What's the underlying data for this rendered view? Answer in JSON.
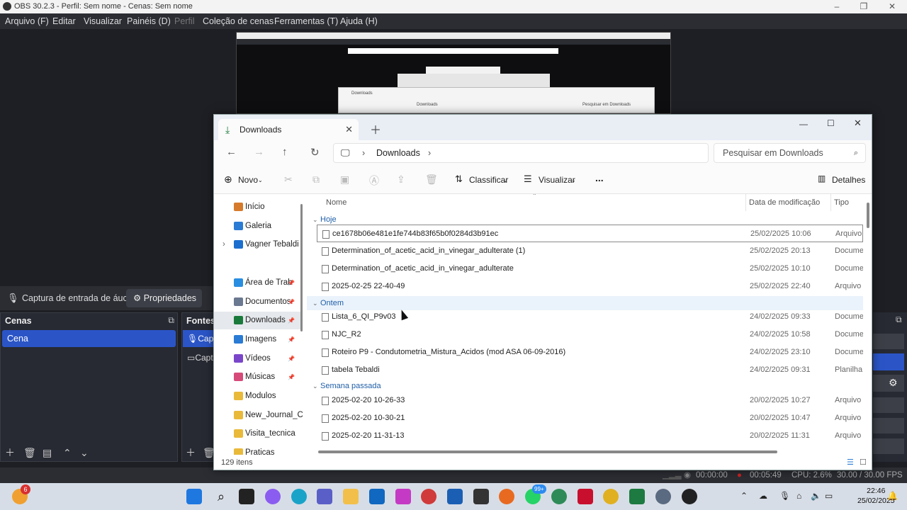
{
  "obs": {
    "title": "OBS 30.2.3 - Perfil: Sem nome - Cenas: Sem nome",
    "menu": [
      "Arquivo (F)",
      "Editar",
      "Visualizar",
      "Painéis (D)",
      "Perfil",
      "Coleção de cenas",
      "Ferramentas (T)",
      "Ajuda (H)"
    ],
    "source_label": "Captura de entrada de áuc",
    "properties_button": "Propriedades",
    "scenes_title": "Cenas",
    "scene_item": "Cena",
    "sources_title": "Fontes",
    "sources": [
      "Capt",
      "Capt"
    ],
    "status": {
      "rec_time": "00:00:00",
      "stream_time": "00:05:49",
      "cpu": "CPU: 2.6%",
      "fps": "30.00 / 30.00 FPS"
    },
    "mini_downloads": "Downloads",
    "mini_search": "Pesquisar em Downloads"
  },
  "explorer": {
    "tab_title": "Downloads",
    "breadcrumb": "Downloads",
    "search_placeholder": "Pesquisar em Downloads",
    "toolbar": {
      "new": "Novo",
      "sort": "Classificar",
      "view": "Visualizar",
      "more": "...",
      "details": "Detalhes"
    },
    "nav": [
      {
        "label": "Início",
        "color": "#d67a2b",
        "pin": false
      },
      {
        "label": "Galeria",
        "color": "#2a7bd4",
        "pin": false
      },
      {
        "label": "Vagner Tebaldi -",
        "color": "#1c6fcf",
        "pin": false
      },
      {
        "label": "Área de Trab",
        "color": "#2a8ee0",
        "pin": true
      },
      {
        "label": "Documentos",
        "color": "#6a7890",
        "pin": true
      },
      {
        "label": "Downloads",
        "color": "#1a7a3c",
        "pin": true
      },
      {
        "label": "Imagens",
        "color": "#2a7bd4",
        "pin": true
      },
      {
        "label": "Vídeos",
        "color": "#7a46c9",
        "pin": true
      },
      {
        "label": "Músicas",
        "color": "#d64a7a",
        "pin": true
      },
      {
        "label": "Modulos",
        "color": "#e9b93a",
        "pin": false
      },
      {
        "label": "New_Journal_Ch",
        "color": "#e9b93a",
        "pin": false
      },
      {
        "label": "Visita_tecnica",
        "color": "#e9b93a",
        "pin": false
      },
      {
        "label": "Praticas",
        "color": "#e9b93a",
        "pin": false
      }
    ],
    "columns": {
      "name": "Nome",
      "date": "Data de modificação",
      "type": "Tipo"
    },
    "groups": [
      {
        "label": "Hoje",
        "files": [
          {
            "name": "ce1678b06e481e1fe744b83f65b0f0284d3b91ec",
            "date": "25/02/2025 10:06",
            "type": "Arquivo C",
            "selected": true
          },
          {
            "name": "Determination_of_acetic_acid_in_vinegar_adulterate (1)",
            "date": "25/02/2025 20:13",
            "type": "Documen"
          },
          {
            "name": "Determination_of_acetic_acid_in_vinegar_adulterate",
            "date": "25/02/2025 10:10",
            "type": "Documen"
          },
          {
            "name": "2025-02-25 22-40-49",
            "date": "25/02/2025 22:40",
            "type": "Arquivo M"
          }
        ]
      },
      {
        "label": "Ontem",
        "files": [
          {
            "name": "Lista_6_QI_P9v03",
            "date": "24/02/2025 09:33",
            "type": "Documen"
          },
          {
            "name": "NJC_R2",
            "date": "24/02/2025 10:58",
            "type": "Documen"
          },
          {
            "name": "Roteiro P9 - Condutometria_Mistura_Acidos (mod ASA 06-09-2016)",
            "date": "24/02/2025 23:10",
            "type": "Documen"
          },
          {
            "name": "tabela Tebaldi",
            "date": "24/02/2025 09:31",
            "type": "Planilha d"
          }
        ]
      },
      {
        "label": "Semana passada",
        "files": [
          {
            "name": "2025-02-20 10-26-33",
            "date": "20/02/2025 10:27",
            "type": "Arquivo M"
          },
          {
            "name": "2025-02-20 10-30-21",
            "date": "20/02/2025 10:47",
            "type": "Arquivo M"
          },
          {
            "name": "2025-02-20 11-31-13",
            "date": "20/02/2025 11:31",
            "type": "Arquivo M"
          }
        ]
      }
    ],
    "item_count": "129 itens"
  },
  "taskbar": {
    "weather_badge": "6",
    "whatsapp_badge": "99+",
    "time": "22:46",
    "date": "25/02/2025"
  }
}
